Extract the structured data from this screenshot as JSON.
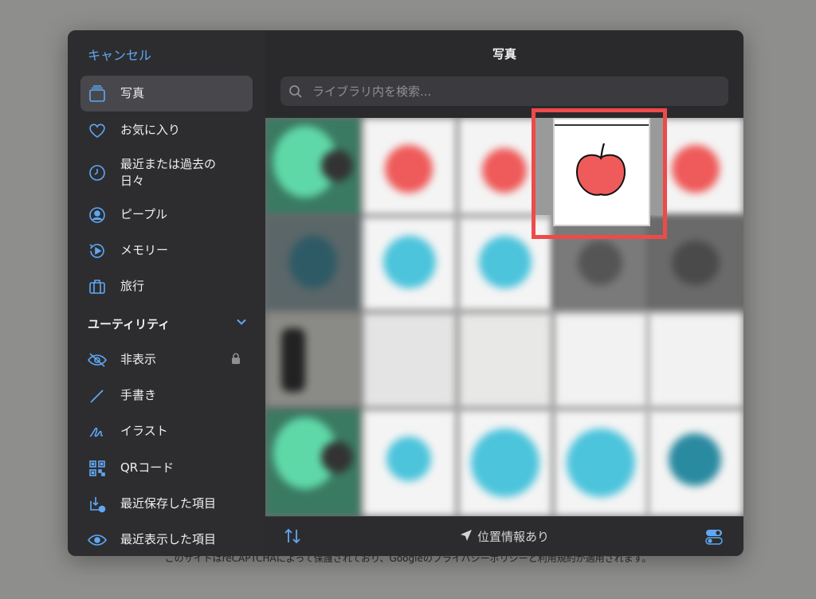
{
  "backdrop": {
    "notice": "このサイトはreCAPTCHAによって保護されており、Googleのプライバシーポリシーと利用規約が適用されます。"
  },
  "sidebar": {
    "cancel_label": "キャンセル",
    "items": [
      {
        "label": "写真",
        "icon": "photos-stack-icon",
        "selected": true
      },
      {
        "label": "お気に入り",
        "icon": "heart-icon"
      },
      {
        "label": "最近または過去の\n日々",
        "icon": "clock-icon"
      },
      {
        "label": "ピープル",
        "icon": "person-circle-icon"
      },
      {
        "label": "メモリー",
        "icon": "memories-play-icon"
      },
      {
        "label": "旅行",
        "icon": "suitcase-icon"
      }
    ],
    "utility_section": {
      "label": "ユーティリティ",
      "icon": "chevron-down-icon"
    },
    "utility_items": [
      {
        "label": "非表示",
        "icon": "eye-slash-icon",
        "badge_icon": "lock-icon"
      },
      {
        "label": "手書き",
        "icon": "pen-icon"
      },
      {
        "label": "イラスト",
        "icon": "scribble-icon"
      },
      {
        "label": "QRコード",
        "icon": "qr-code-icon"
      },
      {
        "label": "最近保存した項目",
        "icon": "download-clock-icon"
      },
      {
        "label": "最近表示した項目",
        "icon": "eye-icon"
      }
    ]
  },
  "main": {
    "title": "写真",
    "search_placeholder": "ライブラリ内を検索...",
    "bottom": {
      "location_label": "位置情報あり",
      "location_icon": "location-arrow-icon",
      "sort_icon": "sort-arrows-icon",
      "options_icon": "toggle-options-icon"
    },
    "selected_thumbnail_icon": "apple-drawing-icon"
  },
  "colors": {
    "accent": "#5fa8f2",
    "highlight": "#ee4a4a",
    "apple_red": "#ef5a5a"
  }
}
